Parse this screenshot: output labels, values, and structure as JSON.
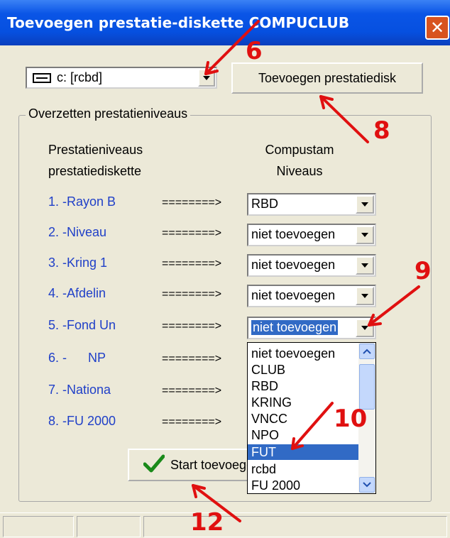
{
  "window": {
    "title": "Toevoegen prestatie-diskette COMPUCLUB",
    "close_glyph": "✕"
  },
  "drive": {
    "value": "c: [rcbd]"
  },
  "toolbar": {
    "add_label": "Toevoegen prestatiedisk"
  },
  "group": {
    "legend": "Overzetten prestatieniveaus",
    "left_header": [
      "Prestatieniveaus",
      "prestatiediskette"
    ],
    "right_header": [
      "Compustam",
      "Niveaus"
    ]
  },
  "rows": [
    {
      "label": "1. -Rayon B",
      "arrow": "========>",
      "value": "RBD"
    },
    {
      "label": "2. -Niveau",
      "arrow": "========>",
      "value": "niet toevoegen"
    },
    {
      "label": "3. -Kring 1",
      "arrow": "========>",
      "value": "niet toevoegen"
    },
    {
      "label": "4. -Afdelin",
      "arrow": "========>",
      "value": "niet toevoegen"
    },
    {
      "label": "5. -Fond Un",
      "arrow": "========>",
      "value": "niet toevoegen"
    },
    {
      "label": "6. -      NP",
      "arrow": "========>"
    },
    {
      "label": "7. -Nationa",
      "arrow": "========>"
    },
    {
      "label": "8. -FU 2000",
      "arrow": "========>"
    }
  ],
  "dropdown": {
    "options": [
      "niet toevoegen",
      "CLUB",
      "RBD",
      "KRING",
      "VNCC",
      "NPO",
      "FUT",
      "rcbd",
      "FU 2000"
    ],
    "selected_index": 6
  },
  "start_button": {
    "label": "Start toevoegen"
  },
  "annotations": [
    "6",
    "8",
    "9",
    "10",
    "12"
  ],
  "colors": {
    "annotation": "#e01010",
    "level_label": "#2040c8",
    "selection": "#316ac5"
  }
}
